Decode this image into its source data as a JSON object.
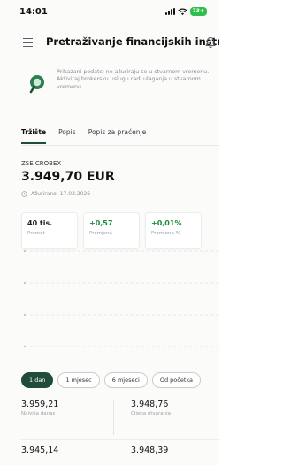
{
  "status_bar": {
    "time": "14:01",
    "battery": "73+"
  },
  "header": {
    "title": "Pretraživanje financijskih instr..."
  },
  "notice": {
    "text": "Prikazani podatci ne ažuriraju se u stvarnom vremenu. Aktiviraj brokersku uslugu radi ulaganja u stvarnom vremenu"
  },
  "tabs": [
    "Tržište",
    "Popis",
    "Popis za praćenje"
  ],
  "instrument": {
    "name": "ZSE CROBEX",
    "value": "3.949,70 EUR",
    "updated": "Ažurirano: 17.03.2026"
  },
  "cards": [
    {
      "value": "40 tis.",
      "label": "Promet"
    },
    {
      "value": "+0,57",
      "label": "Promjena"
    },
    {
      "value": "+0,01%",
      "label": "Promjena %"
    }
  ],
  "chart": {
    "gridlines": 4
  },
  "periods": [
    "1 dan",
    "1 mjesec",
    "6 mjeseci",
    "Od početka"
  ],
  "stats": [
    {
      "value": "3.959,21",
      "label": "Najviša danas"
    },
    {
      "value": "3.948,76",
      "label": "Cijena otvaranja"
    },
    {
      "value": "3.945,14",
      "label": ""
    },
    {
      "value": "3.948,39",
      "label": ""
    }
  ],
  "colors": {
    "accent": "#1f4d3a",
    "positive": "#1c8a3a",
    "battery": "#2fbf4a"
  }
}
